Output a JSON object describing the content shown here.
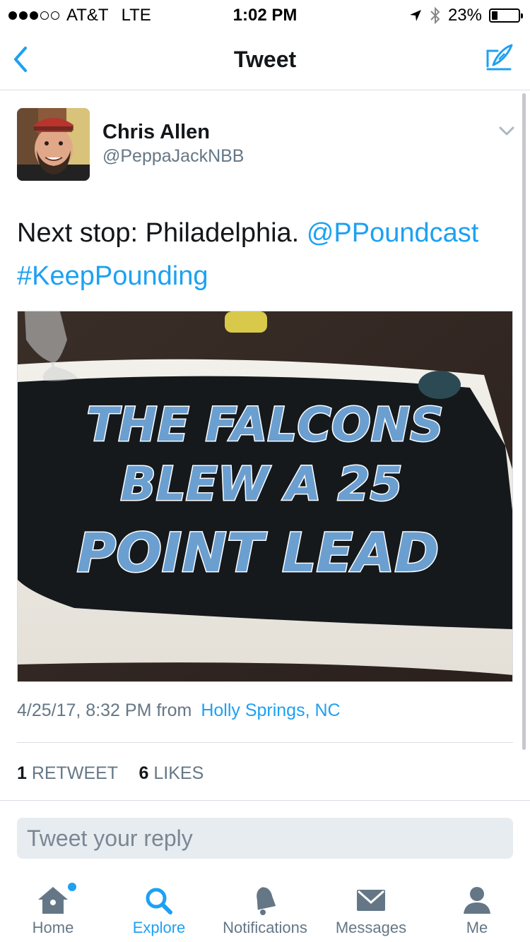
{
  "status_bar": {
    "carrier": "AT&T",
    "network": "LTE",
    "time": "1:02 PM",
    "battery": "23%",
    "battery_level": 0.23,
    "signal_bars_filled": 3,
    "signal_bars_total": 5
  },
  "nav": {
    "title": "Tweet",
    "back_icon": "chevron-left-icon",
    "compose_icon": "compose-quill-icon"
  },
  "tweet": {
    "author_name": "Chris Allen",
    "author_handle": "@PeppaJackNBB",
    "text_plain": "Next stop: Philadelphia.",
    "mention": "@PPoundcast",
    "hashtag": "#KeepPounding",
    "photo": {
      "line1": "THE FALCONS",
      "line2": "BLEW A 25",
      "line3": "POINT LEAD"
    },
    "timestamp": "4/25/17, 8:32 PM",
    "from_label": "from",
    "location": "Holly Springs, NC",
    "retweet_count": "1",
    "retweet_label": "RETWEET",
    "like_count": "6",
    "like_label": "LIKES"
  },
  "reply": {
    "placeholder": "Tweet your reply"
  },
  "tabs": [
    {
      "label": "Home",
      "icon": "home-icon",
      "active": false,
      "badge": true
    },
    {
      "label": "Explore",
      "icon": "search-icon",
      "active": true
    },
    {
      "label": "Notifications",
      "icon": "bell-icon",
      "active": false
    },
    {
      "label": "Messages",
      "icon": "envelope-icon",
      "active": false
    },
    {
      "label": "Me",
      "icon": "person-icon",
      "active": false
    }
  ],
  "colors": {
    "accent": "#1da1f2",
    "text_primary": "#14171a",
    "text_secondary": "#657786",
    "divider": "#d8dde2",
    "reply_bg": "#e6ecf0"
  }
}
